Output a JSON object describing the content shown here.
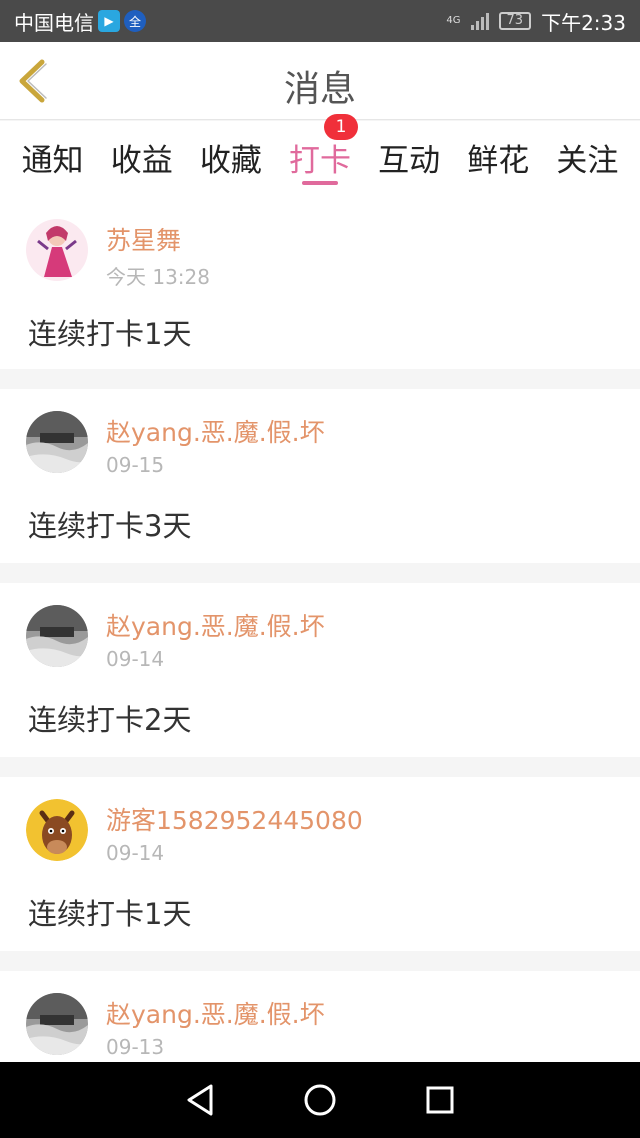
{
  "status_bar": {
    "carrier": "中国电信",
    "network": "4G",
    "battery": "73",
    "time": "下午2:33",
    "app_icon_1": "video-app-icon",
    "app_icon_2": "全",
    "colors": {
      "bg": "#4a4a4a"
    }
  },
  "header": {
    "title": "消息",
    "back_icon": "chevron-left-icon",
    "colors": {
      "back": "#c9a63b"
    }
  },
  "tabs": [
    {
      "label": "通知",
      "active": false
    },
    {
      "label": "收益",
      "active": false
    },
    {
      "label": "收藏",
      "active": false
    },
    {
      "label": "打卡",
      "active": true,
      "badge": "1"
    },
    {
      "label": "互动",
      "active": false
    },
    {
      "label": "鲜花",
      "active": false
    },
    {
      "label": "关注",
      "active": false
    }
  ],
  "colors": {
    "accent": "#e06a9c",
    "username": "#e3946a",
    "badge": "#f0303a"
  },
  "messages": [
    {
      "name": "苏星舞",
      "time": "今天 13:28",
      "text": "连续打卡1天",
      "avatar": "anime-avatar"
    },
    {
      "name": "赵yang.恶.魔.假.坏",
      "time": "09-15",
      "text": "连续打卡3天",
      "avatar": "landscape-avatar"
    },
    {
      "name": "赵yang.恶.魔.假.坏",
      "time": "09-14",
      "text": "连续打卡2天",
      "avatar": "landscape-avatar"
    },
    {
      "name": "游客1582952445080",
      "time": "09-14",
      "text": "连续打卡1天",
      "avatar": "horse-avatar"
    },
    {
      "name": "赵yang.恶.魔.假.坏",
      "time": "09-13",
      "text": "",
      "avatar": "landscape-avatar"
    }
  ],
  "nav_bar": {
    "back_icon": "triangle-back-icon",
    "home_icon": "circle-home-icon",
    "recents_icon": "square-recents-icon"
  }
}
